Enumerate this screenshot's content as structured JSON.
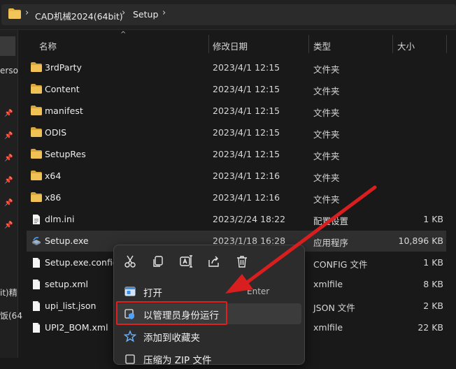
{
  "breadcrumb": {
    "items": [
      "CAD机械2024(64bit)",
      "Setup"
    ]
  },
  "sidebar": {
    "fragments": [
      "erso",
      "it)精",
      "饭(64"
    ]
  },
  "columns": {
    "name": "名称",
    "modified": "修改日期",
    "type": "类型",
    "size": "大小"
  },
  "files": [
    {
      "name": "3rdParty",
      "modified": "2023/4/1 12:15",
      "type": "文件夹",
      "size": "",
      "icon": "folder-icon"
    },
    {
      "name": "Content",
      "modified": "2023/4/1 12:15",
      "type": "文件夹",
      "size": "",
      "icon": "folder-icon"
    },
    {
      "name": "manifest",
      "modified": "2023/4/1 12:15",
      "type": "文件夹",
      "size": "",
      "icon": "folder-icon"
    },
    {
      "name": "ODIS",
      "modified": "2023/4/1 12:15",
      "type": "文件夹",
      "size": "",
      "icon": "folder-icon"
    },
    {
      "name": "SetupRes",
      "modified": "2023/4/1 12:15",
      "type": "文件夹",
      "size": "",
      "icon": "folder-icon"
    },
    {
      "name": "x64",
      "modified": "2023/4/1 12:16",
      "type": "文件夹",
      "size": "",
      "icon": "folder-icon"
    },
    {
      "name": "x86",
      "modified": "2023/4/1 12:16",
      "type": "文件夹",
      "size": "",
      "icon": "folder-icon"
    },
    {
      "name": "dlm.ini",
      "modified": "2023/2/24 18:22",
      "type": "配置设置",
      "size": "1 KB",
      "icon": "ini-file-icon"
    },
    {
      "name": "Setup.exe",
      "modified": "2023/1/18 16:28",
      "type": "应用程序",
      "size": "10,896 KB",
      "icon": "exe-file-icon"
    },
    {
      "name": "Setup.exe.config",
      "modified": "",
      "type": "CONFIG 文件",
      "size": "1 KB",
      "icon": "file-icon"
    },
    {
      "name": "setup.xml",
      "modified": "",
      "type": "xmlfile",
      "size": "8 KB",
      "icon": "file-icon"
    },
    {
      "name": "upi_list.json",
      "modified": "",
      "type": "JSON 文件",
      "size": "2 KB",
      "icon": "file-icon"
    },
    {
      "name": "UPI2_BOM.xml",
      "modified": "",
      "type": "xmlfile",
      "size": "22 KB",
      "icon": "file-icon"
    }
  ],
  "context_menu": {
    "toolbar": [
      "cut-icon",
      "copy-icon",
      "rename-icon",
      "share-icon",
      "delete-icon"
    ],
    "items": [
      {
        "label": "打开",
        "shortcut": "Enter"
      },
      {
        "label": "以管理员身份运行",
        "shortcut": ""
      },
      {
        "label": "添加到收藏夹",
        "shortcut": ""
      },
      {
        "label": "压缩为 ZIP 文件",
        "shortcut": ""
      }
    ]
  },
  "colors": {
    "folder": "#e8b649",
    "highlight_box": "#e0201e",
    "arrow": "#d81e1e",
    "accent_blue": "#4ea3ff"
  }
}
